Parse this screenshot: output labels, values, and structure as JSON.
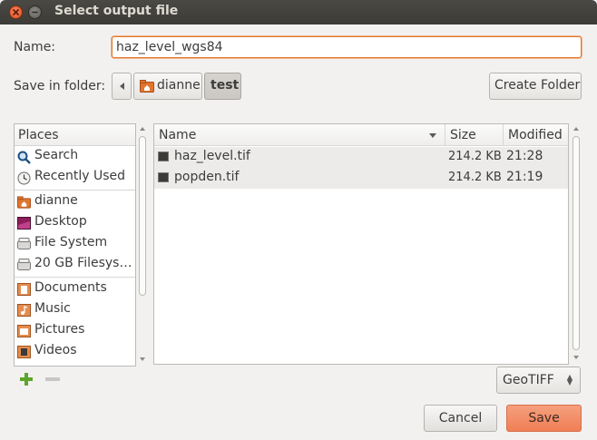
{
  "window": {
    "title": "Select output file"
  },
  "name_field": {
    "label": "Name:",
    "value": "haz_level_wgs84"
  },
  "save_in": {
    "label": "Save in folder:",
    "crumbs": [
      "dianne",
      "test"
    ],
    "create_folder_label": "Create Folder"
  },
  "places": {
    "header": "Places",
    "items": [
      {
        "label": "Search",
        "icon": "search-icon"
      },
      {
        "label": "Recently Used",
        "icon": "recent-icon"
      },
      {
        "label": "dianne",
        "icon": "home-folder-icon"
      },
      {
        "label": "Desktop",
        "icon": "desktop-icon"
      },
      {
        "label": "File System",
        "icon": "drive-icon"
      },
      {
        "label": "20 GB Filesys…",
        "icon": "drive-icon"
      },
      {
        "label": "Documents",
        "icon": "documents-icon"
      },
      {
        "label": "Music",
        "icon": "music-icon"
      },
      {
        "label": "Pictures",
        "icon": "pictures-icon"
      },
      {
        "label": "Videos",
        "icon": "videos-icon"
      }
    ]
  },
  "files": {
    "columns": {
      "name": "Name",
      "size": "Size",
      "modified": "Modified"
    },
    "rows": [
      {
        "name": "haz_level.tif",
        "size": "214.2 KB",
        "modified": "21:28"
      },
      {
        "name": "popden.tif",
        "size": "214.2 KB",
        "modified": "21:19"
      }
    ]
  },
  "filter": {
    "value": "GeoTIFF"
  },
  "buttons": {
    "cancel": "Cancel",
    "save": "Save"
  },
  "colors": {
    "accent": "#e0762e",
    "save_button": "#ef7e55",
    "titlebar": "#3c3b37"
  }
}
